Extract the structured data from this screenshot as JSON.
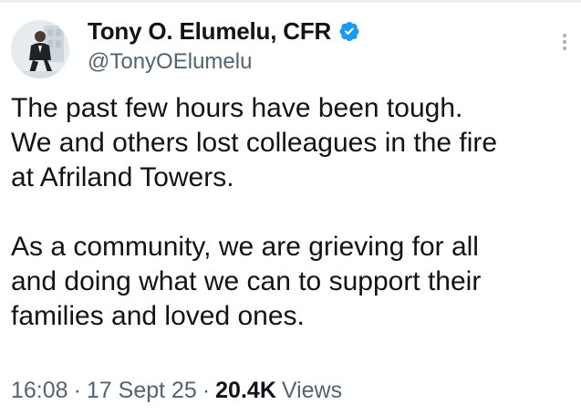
{
  "author": {
    "display_name": "Tony O. Elumelu, CFR",
    "handle": "@TonyOElumelu",
    "verified_icon": "verified-badge-icon",
    "avatar_icon": "profile-avatar"
  },
  "tweet": {
    "paragraphs": [
      "The past few hours have been tough.\nWe and others lost colleagues in the fire\nat Afriland Towers.",
      "As a community, we are grieving for all\nand doing what we can to support their\nfamilies and loved ones."
    ]
  },
  "meta": {
    "time": "16:08",
    "date": "17 Sept 25",
    "separator": "·",
    "views_count": "20.4K",
    "views_label": "Views"
  },
  "colors": {
    "text_primary": "#0f1419",
    "text_secondary": "#536471",
    "verified_blue": "#1d9bf0"
  }
}
